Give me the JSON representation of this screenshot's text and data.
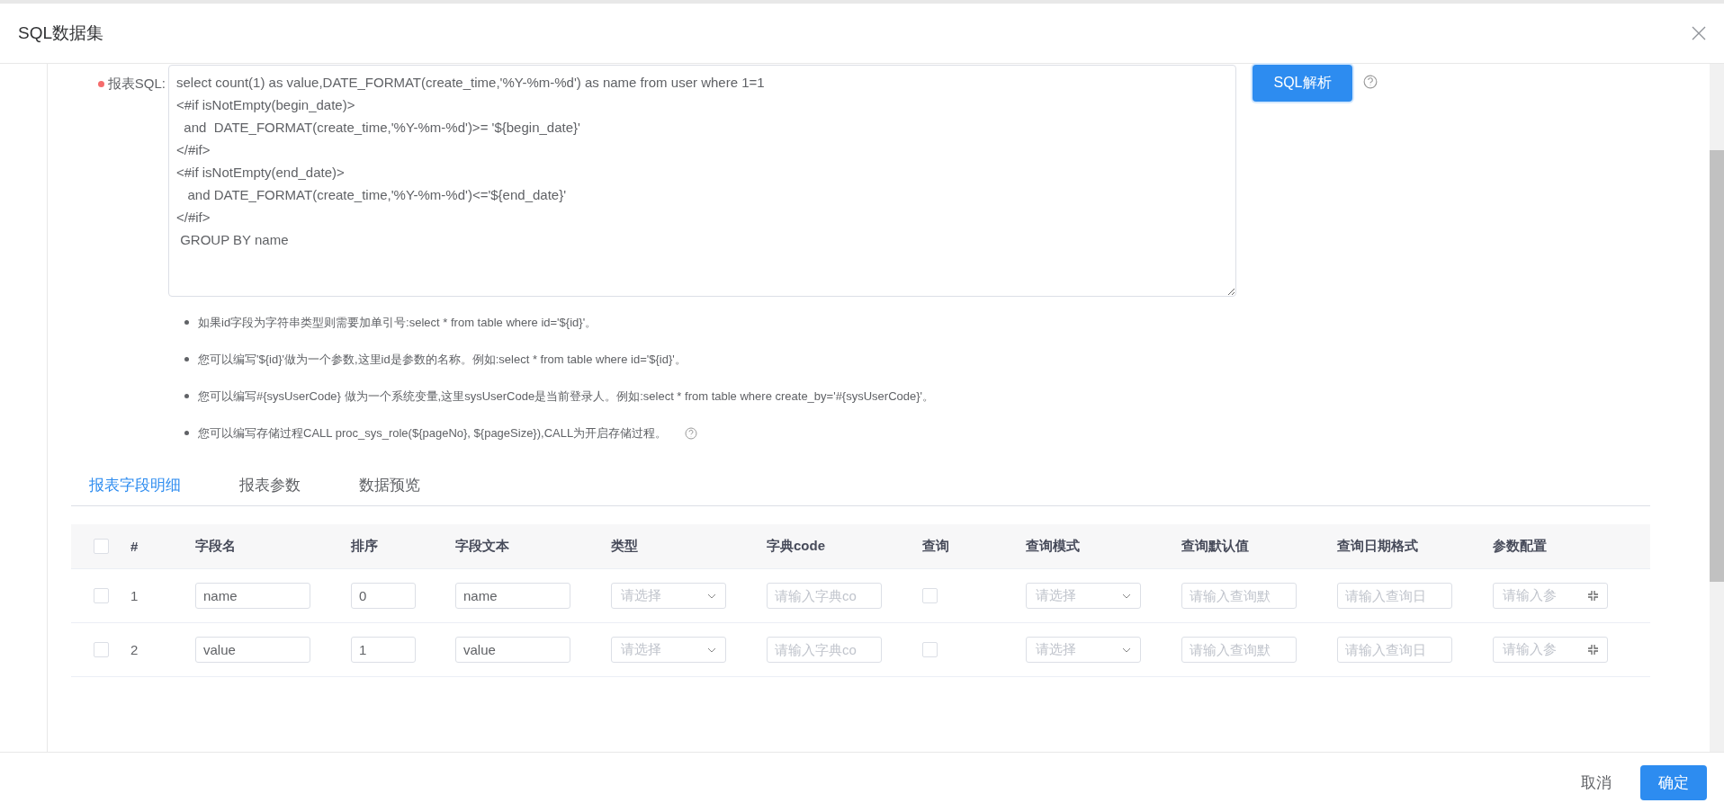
{
  "dialog": {
    "title": "SQL数据集"
  },
  "sql_field": {
    "label": "报表SQL:",
    "required": true,
    "value": "select count(1) as value,DATE_FORMAT(create_time,'%Y-%m-%d') as name from user where 1=1\n<#if isNotEmpty(begin_date)>\n  and  DATE_FORMAT(create_time,'%Y-%m-%d')>= '${begin_date}'\n</#if>\n<#if isNotEmpty(end_date)>\n   and DATE_FORMAT(create_time,'%Y-%m-%d')<='${end_date}'\n</#if>\n GROUP BY name",
    "parse_button": "SQL解析"
  },
  "hints": [
    "如果id字段为字符串类型则需要加单引号:select * from table where id='${id}'。",
    "您可以编写'${id}'做为一个参数,这里id是参数的名称。例如:select * from table where id='${id}'。",
    "您可以编写#{sysUserCode} 做为一个系统变量,这里sysUserCode是当前登录人。例如:select * from table where create_by='#{sysUserCode}'。",
    "您可以编写存储过程CALL proc_sys_role(${pageNo}, ${pageSize}),CALL为开启存储过程。"
  ],
  "tabs": [
    {
      "label": "报表字段明细",
      "selected": true
    },
    {
      "label": "报表参数",
      "selected": false
    },
    {
      "label": "数据预览",
      "selected": false
    }
  ],
  "table": {
    "all_checked": false,
    "columns": [
      "#",
      "字段名",
      "排序",
      "字段文本",
      "类型",
      "字典code",
      "查询",
      "查询模式",
      "查询默认值",
      "查询日期格式",
      "参数配置"
    ],
    "rows": [
      {
        "checked": false,
        "index": "1",
        "field_name": "name",
        "order": "0",
        "field_text": "name",
        "type_placeholder": "请选择",
        "dict_placeholder": "请输入字典co",
        "query": false,
        "mode_placeholder": "请选择",
        "default_placeholder": "请输入查询默",
        "date_placeholder": "请输入查询日",
        "param_placeholder": "请输入参"
      },
      {
        "checked": false,
        "index": "2",
        "field_name": "value",
        "order": "1",
        "field_text": "value",
        "type_placeholder": "请选择",
        "dict_placeholder": "请输入字典co",
        "query": false,
        "mode_placeholder": "请选择",
        "default_placeholder": "请输入查询默",
        "date_placeholder": "请输入查询日",
        "param_placeholder": "请输入参"
      }
    ]
  },
  "footer": {
    "cancel": "取消",
    "ok": "确定"
  }
}
